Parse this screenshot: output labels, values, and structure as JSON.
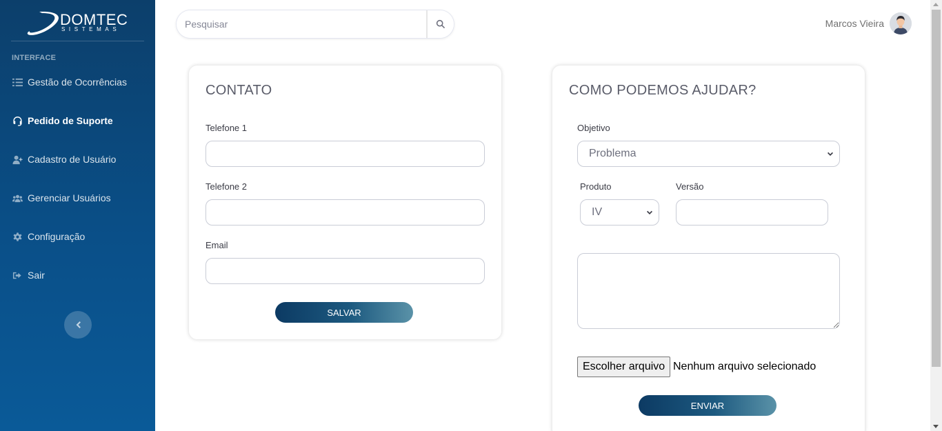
{
  "brand": {
    "name": "DOMTEC",
    "subtitle": "SISTEMAS"
  },
  "sidebar": {
    "heading": "INTERFACE",
    "items": [
      {
        "label": "Gestão de Ocorrências",
        "icon": "tasks-icon",
        "active": false
      },
      {
        "label": "Pedido de Suporte",
        "icon": "headset-icon",
        "active": true
      },
      {
        "label": "Cadastro de Usuário",
        "icon": "user-plus-icon",
        "active": false
      },
      {
        "label": "Gerenciar Usuários",
        "icon": "users-icon",
        "active": false
      },
      {
        "label": "Configuração",
        "icon": "gear-icon",
        "active": false
      },
      {
        "label": "Sair",
        "icon": "sign-out-icon",
        "active": false
      }
    ]
  },
  "search": {
    "placeholder": "Pesquisar",
    "value": ""
  },
  "user": {
    "name": "Marcos Vieira"
  },
  "contact": {
    "title": "CONTATO",
    "phone1_label": "Telefone 1",
    "phone1_value": "",
    "phone2_label": "Telefone 2",
    "phone2_value": "",
    "email_label": "Email",
    "email_value": "",
    "save_label": "SALVAR"
  },
  "help": {
    "title": "COMO PODEMOS AJUDAR?",
    "objective_label": "Objetivo",
    "objective_value": "Problema",
    "product_label": "Produto",
    "product_value": "IV",
    "version_label": "Versão",
    "version_value": "",
    "message_value": "",
    "file_button_label": "Escolher arquivo",
    "file_status": "Nenhum arquivo selecionado",
    "send_label": "ENVIAR"
  },
  "colors": {
    "sidebar_top": "#0c3f6b",
    "sidebar_bottom": "#0a5a98",
    "button_start": "#0c3a63",
    "button_end": "#5a92a8"
  }
}
